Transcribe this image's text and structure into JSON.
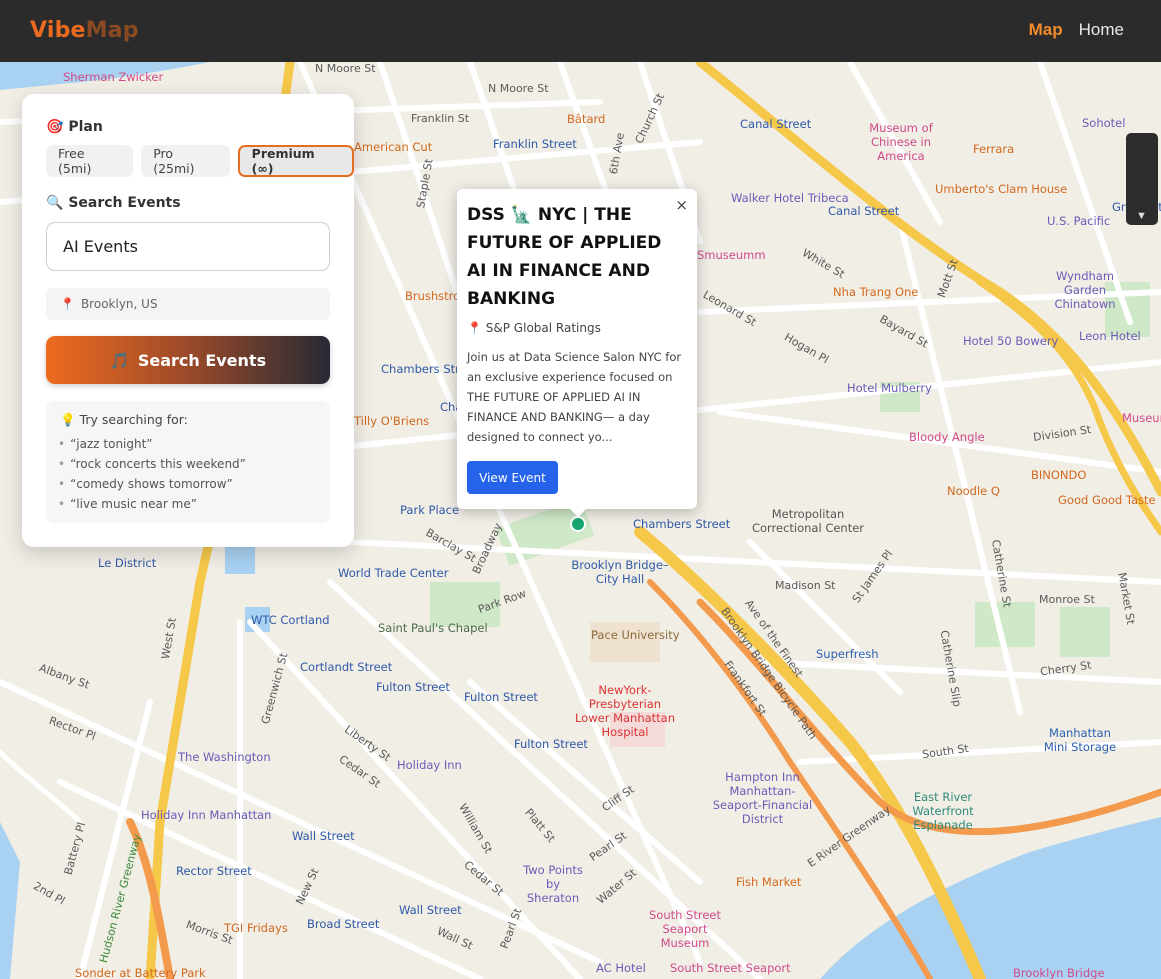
{
  "app": {
    "logo_part1": "Vibe",
    "logo_part2": "Map"
  },
  "nav": {
    "map": "Map",
    "home": "Home"
  },
  "panel": {
    "plan_title": "Plan",
    "plans": [
      "Free (5mi)",
      "Pro (25mi)",
      "Premium (∞)"
    ],
    "selected_plan": "Premium (∞)",
    "search_title": "Search Events",
    "search_value": "AI Events",
    "location": "Brooklyn, US",
    "search_button": "Search Events",
    "tips_title": "Try searching for:",
    "tips": [
      "“jazz tonight”",
      "“rock concerts this weekend”",
      "“comedy shows tomorrow”",
      "“live music near me”"
    ]
  },
  "popup": {
    "close": "×",
    "title": "DSS 🗽 NYC | THE FUTURE OF APPLIED AI IN FINANCE AND BANKING",
    "venue": "S&P Global Ratings",
    "description": "Join us at Data Science Salon NYC for an exclusive experience focused on THE FUTURE OF APPLIED AI IN FINANCE AND BANKING— a day designed to connect yo...",
    "button": "View Event"
  },
  "map_labels": {
    "pois": [
      "Sherman Zwicker",
      "Bâtard",
      "Museum of Chinese in America",
      "Ferrara",
      "Umberto's Clam House",
      "Walker Hotel Tribeca",
      "Canal Street",
      "Franklin Street",
      "Canal Street",
      "Grand St",
      "U.S. Pacific",
      "Wyndham Garden Chinatown",
      "Leon Hotel",
      "Hotel 50 Bowery",
      "Nha Trang One",
      "Hotel Mulberry",
      "Bloody Angle",
      "BINONDO",
      "Good Good Taste",
      "Noodle Q",
      "Metropolitan Correctional Center",
      "Chambers Street",
      "Brooklyn Bridge–City Hall",
      "Pace University",
      "NewYork-Presbyterian Lower Manhattan Hospital",
      "Superfresh",
      "Saint Paul's Chapel",
      "World Trade Center",
      "WTC Cortland",
      "Cortlandt Street",
      "Fulton Street",
      "Fulton Street",
      "Fulton Street",
      "Park Place",
      "Chambers Street",
      "Le District",
      "The Washington",
      "Holiday Inn",
      "Holiday Inn Manhattan",
      "Wall Street",
      "Rector Street",
      "Wall Street",
      "Broad Street",
      "TGI Fridays",
      "Sonder at Battery Park",
      "Two Points by Sheraton",
      "Hampton Inn Manhattan-Seaport-Financial District",
      "Fish Market",
      "South Street Seaport Museum",
      "AC Hotel",
      "South Street Seaport",
      "East River Waterfront Esplanade",
      "Manhattan Mini Storage",
      "Brooklyn Bridge",
      "Smuseumm",
      "Brushstroke",
      "American Cut",
      "Sohotel",
      "Museum of Eldridge",
      "Tilly O'Briens",
      "Chambers Street",
      "Sonder at Battery Park"
    ],
    "streets": [
      "N Moore St",
      "N Moore St",
      "Franklin St",
      "Church St",
      "6th Ave",
      "Staple St",
      "White St",
      "Leonard St",
      "Hogan Pl",
      "Bayard St",
      "Mott St",
      "Division St",
      "Barclay St",
      "Broadway",
      "Park Row",
      "Madison St",
      "St James Pl",
      "Catherine St",
      "Monroe St",
      "Market St",
      "Cherry St",
      "Catherine Slip",
      "South St",
      "Ave of the Finest",
      "Brooklyn Bridge Bicycle Path",
      "Frankfort St",
      "E River Greenway",
      "West St",
      "Greenwich St",
      "Albany St",
      "Rector Pl",
      "Liberty St",
      "Cedar St",
      "Cliff St",
      "Platt St",
      "Pearl St",
      "William St",
      "Water St",
      "Battery Pl",
      "2nd Pl",
      "New St",
      "Morris St",
      "Hudson River Greenway",
      "Wall St",
      "Pearl St",
      "Cedar St"
    ]
  }
}
